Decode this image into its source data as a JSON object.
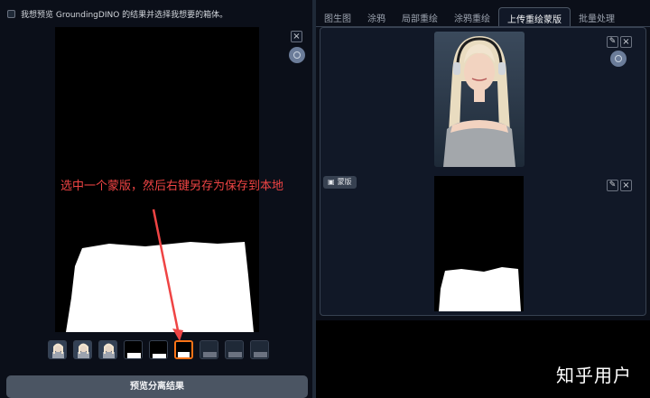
{
  "options": {
    "preview_dino_label": "我想预览 GroundingDINO 的结果并选择我想要的箱体。"
  },
  "annotation": {
    "text": "选中一个蒙版，然后右键另存为保存到本地",
    "color": "#ef4444"
  },
  "thumbnails": [
    {
      "kind": "portrait",
      "selected": false
    },
    {
      "kind": "portrait",
      "selected": false
    },
    {
      "kind": "portrait",
      "selected": false
    },
    {
      "kind": "mask",
      "selected": false
    },
    {
      "kind": "mask",
      "selected": false
    },
    {
      "kind": "mask",
      "selected": true
    },
    {
      "kind": "dim",
      "selected": false
    },
    {
      "kind": "dim",
      "selected": false
    },
    {
      "kind": "dim",
      "selected": false
    }
  ],
  "buttons": {
    "preview_segmentation": "预览分离结果",
    "close_glyph": "×",
    "edit_glyph": "✎"
  },
  "tabs": [
    {
      "label": "图生图",
      "active": false
    },
    {
      "label": "涂鸦",
      "active": false
    },
    {
      "label": "局部重绘",
      "active": false
    },
    {
      "label": "涂鸦重绘",
      "active": false
    },
    {
      "label": "上传重绘蒙版",
      "active": true
    },
    {
      "label": "批量处理",
      "active": false
    }
  ],
  "mask_panel": {
    "label": "蒙版"
  },
  "watermark": "知乎用户",
  "colors": {
    "accent_selected": "#f97316",
    "background": "#0b0f19",
    "panel": "#111827"
  }
}
